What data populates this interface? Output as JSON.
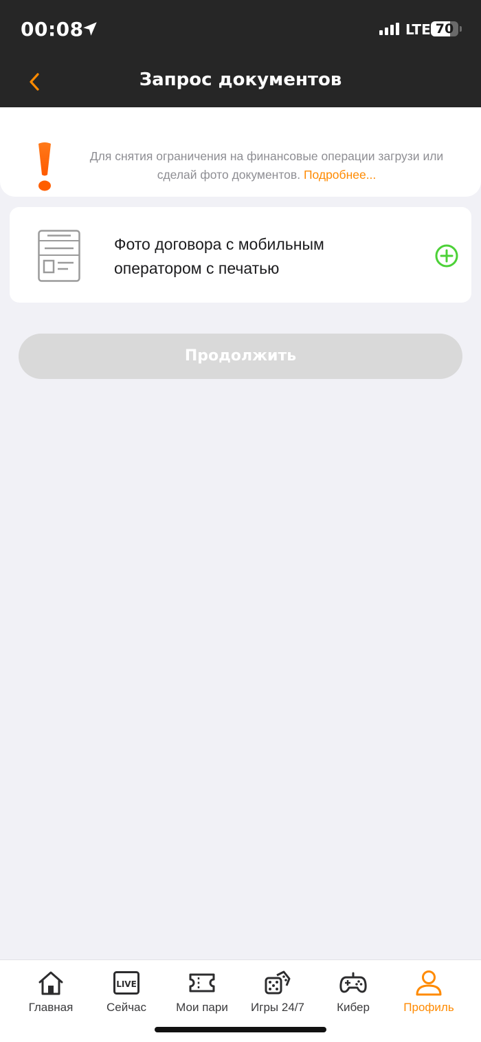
{
  "status_bar": {
    "time": "00:08",
    "network": "LTE",
    "battery": "70",
    "battery_level": 0.7
  },
  "nav": {
    "title": "Запрос документов",
    "back_icon": "chevron-left-icon"
  },
  "notice": {
    "icon": "exclamation-icon",
    "text": "Для снятия ограничения на финансовые операции загрузи или сделай фото документов.",
    "link": "Подробнее..."
  },
  "documents": [
    {
      "title": "Фото договора с мобильным оператором с печатью",
      "icon": "document-icon",
      "action_icon": "plus-circle-icon"
    }
  ],
  "continue_button": {
    "label": "Продолжить"
  },
  "tabs": [
    {
      "label": "Главная",
      "icon": "home-icon",
      "active": false
    },
    {
      "label": "Сейчас",
      "icon": "live-icon",
      "active": false
    },
    {
      "label": "Мои пари",
      "icon": "ticket-icon",
      "active": false
    },
    {
      "label": "Игры 24/7",
      "icon": "dice-icon",
      "active": false
    },
    {
      "label": "Кибер",
      "icon": "gamepad-icon",
      "active": false
    },
    {
      "label": "Профиль",
      "icon": "profile-icon",
      "active": true
    }
  ],
  "colors": {
    "accent": "#ff8a00",
    "add_green": "#4cd137",
    "header_bg": "#262626",
    "page_bg": "#f1f1f6",
    "disabled_button": "#d9d9d9"
  }
}
